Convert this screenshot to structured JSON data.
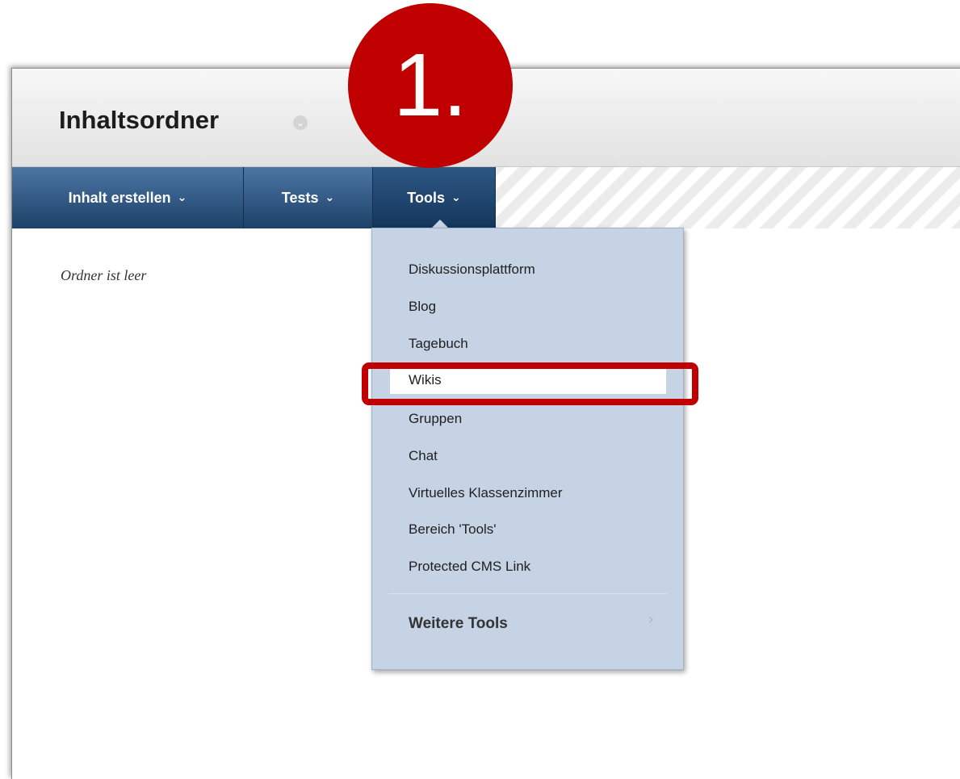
{
  "page": {
    "title": "Inhaltsordner",
    "empty_message": "Ordner ist leer"
  },
  "toolbar": {
    "items": [
      {
        "label": "Inhalt erstellen"
      },
      {
        "label": "Tests"
      },
      {
        "label": "Tools"
      }
    ]
  },
  "dropdown": {
    "items": [
      {
        "label": "Diskussionsplattform"
      },
      {
        "label": "Blog"
      },
      {
        "label": "Tagebuch"
      },
      {
        "label": "Wikis"
      },
      {
        "label": "Gruppen"
      },
      {
        "label": "Chat"
      },
      {
        "label": "Virtuelles Klassenzimmer"
      },
      {
        "label": "Bereich 'Tools'"
      },
      {
        "label": "Protected CMS Link"
      }
    ],
    "more_label": "Weitere Tools",
    "highlighted_item": "Wikis"
  },
  "annotation": {
    "step_label": "1."
  },
  "colors": {
    "toolbar": "#1d4168",
    "dropdown_bg": "#c6d3e4",
    "annotation_red": "#c00000"
  },
  "icons": {
    "title_menu": "chevron-down-icon",
    "more_arrow": "chevron-right-icon"
  }
}
